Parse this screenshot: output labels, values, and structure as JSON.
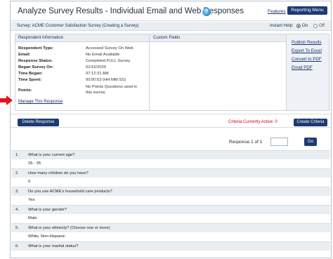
{
  "header": {
    "title": "Analyze Survey Results - Individual Email and Web Responses",
    "features_link": "Features",
    "reporting_menu": "Reporting Menu"
  },
  "survey_bar": {
    "survey_label": "Survey: ACME Customer Satisfaction Survey (Creating a Survey)",
    "instant_help_label": "Instant Help:",
    "on_label": "On",
    "off_label": "Off",
    "instant_help_selected": "On"
  },
  "respondent_info": {
    "title": "Respondent Information",
    "fields": [
      {
        "label": "Respondent Type:",
        "value": "Accessed Survey On Web"
      },
      {
        "label": "Email:",
        "value": "No Email Available"
      },
      {
        "label": "Response Status:",
        "value": "Completed FULL Survey"
      },
      {
        "label": "Began Survey On:",
        "value": "01/16/2020"
      },
      {
        "label": "Time Began:",
        "value": "07:12:31 AM"
      },
      {
        "label": "Time Spent:",
        "value": "00:00:53 (HH:MM:SS)"
      },
      {
        "label": "Points:",
        "value_line1": "No Points Questions used in",
        "value_line2": "this survey."
      }
    ],
    "manage_link": "Manage This Response"
  },
  "custom_fields": {
    "title": "Custom Fields"
  },
  "side_links": [
    "Publish Results",
    "Export To Excel",
    "Convert to PDF",
    "Email PDF"
  ],
  "actions": {
    "delete_label": "Delete Response",
    "criteria_text": "Criteria Currently Active: 0",
    "create_criteria_label": "Create Criteria"
  },
  "pager": {
    "response_count": "Response 1 of 1",
    "go_label": "Go"
  },
  "questions": [
    {
      "num": "1.",
      "text": "What is your current age?",
      "answer": "26 - 35"
    },
    {
      "num": "2.",
      "text": "How many children do you have?",
      "answer": "0"
    },
    {
      "num": "3.",
      "text": "Do you use ACME's household care products?",
      "answer": "Yes"
    },
    {
      "num": "4.",
      "text": "What is your gender?",
      "answer": "Male"
    },
    {
      "num": "5.",
      "text": "What is your ethnicity? (Choose one or more)",
      "answer": "White, Non-Hispanic"
    },
    {
      "num": "6.",
      "text": "What is your marital status?",
      "answer": ""
    }
  ],
  "colors": {
    "accent": "#1d3a72",
    "criteria_red": "#d0021b",
    "arrow_red": "#e3131b"
  }
}
